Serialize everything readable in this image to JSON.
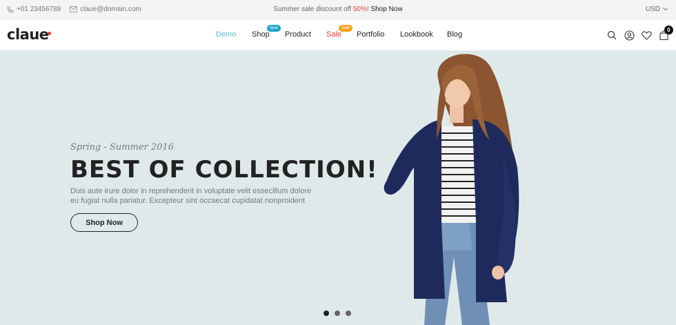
{
  "topbar": {
    "phone": "+01 23456789",
    "email": "claue@domain.com",
    "promo_text": "Summer sale discount off ",
    "promo_percent": "50%",
    "promo_excl": "! ",
    "promo_link": "Shop Now",
    "currency": "USD"
  },
  "header": {
    "logo": "claue",
    "nav": [
      {
        "label": "Demo"
      },
      {
        "label": "Shop",
        "badge": "New"
      },
      {
        "label": "Product"
      },
      {
        "label": "Sale",
        "badge": "Sale"
      },
      {
        "label": "Portfolio"
      },
      {
        "label": "Lookbook"
      },
      {
        "label": "Blog"
      }
    ],
    "icons": [
      "search-icon",
      "user-icon",
      "heart-icon",
      "cart-icon"
    ],
    "cart_count": "0",
    "colors": {
      "active": "#4fbfd1",
      "sale": "#e53935",
      "badge_new": "#1aa6c7",
      "badge_sale": "#f7a21b"
    }
  },
  "hero": {
    "subtitle": "Spring - Summer 2016",
    "title": "BEST OF COLLECTION!",
    "description_line1": "Duis aute irure dolor in reprehenderit in voluptate velit essecillum dolore",
    "description_line2": "eu fugiat nulla pariatur. Excepteur sint occaecat cupidatat nonproident",
    "button": "Shop Now",
    "background": "#dfe9ea",
    "slides": 3,
    "active_slide": 1
  }
}
